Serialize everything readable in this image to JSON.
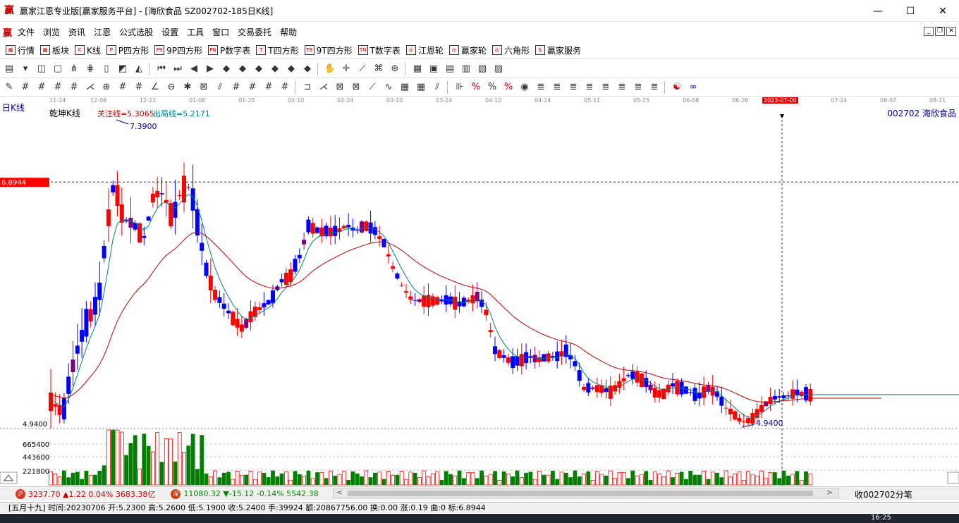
{
  "window": {
    "logo": "赢",
    "title": "赢家江恩专业版[赢家服务平台] - [海欣食品  SZ002702-185日K线]",
    "minimize": "—",
    "maximize": "☐",
    "close": "✕"
  },
  "menu": {
    "logo": "赢",
    "items": [
      "文件",
      "浏览",
      "资讯",
      "江恩",
      "公式选股",
      "设置",
      "工具",
      "窗口",
      "交易委托",
      "帮助"
    ],
    "mdi": [
      "_",
      "❐",
      "✕"
    ]
  },
  "toolbar1": {
    "items": [
      {
        "label": "行情",
        "icon": "grid-icon"
      },
      {
        "label": "板块",
        "icon": "blocks-icon"
      },
      {
        "label": "K线",
        "icon": "kline-icon"
      },
      {
        "label": "P四方形",
        "icon": "p-square-icon"
      },
      {
        "label": "9P四方形",
        "icon": "p9-square-icon"
      },
      {
        "label": "P数字表",
        "icon": "pn-table-icon"
      },
      {
        "label": "T四方形",
        "icon": "t-square-icon"
      },
      {
        "label": "9T四方形",
        "icon": "t9-square-icon"
      },
      {
        "label": "T数字表",
        "icon": "tn-table-icon"
      },
      {
        "label": "江恩轮",
        "icon": "gann-wheel-icon"
      },
      {
        "label": "赢家轮",
        "icon": "winner-wheel-icon"
      },
      {
        "label": "六角形",
        "icon": "hexagon-icon"
      },
      {
        "label": "赢家服务",
        "icon": "dollar-icon"
      }
    ],
    "icon_text": [
      "▦",
      "▩",
      "K",
      "P",
      "P9",
      "PN",
      "T",
      "T9",
      "TN",
      "◎",
      "◎",
      "◎",
      "$"
    ]
  },
  "dates": {
    "ticks": [
      "11-24",
      "12-08",
      "12-22",
      "01-06",
      "01-20",
      "02-10",
      "02-24",
      "03-10",
      "03-24",
      "04-10",
      "04-24",
      "05-11",
      "05-25",
      "06-08",
      "06-26",
      "2023-07-06",
      "07-24",
      "08-07",
      "08-21"
    ],
    "highlight_index": 15
  },
  "chart": {
    "period_label": "日K线",
    "indicator_name": "乾坤K线",
    "attention_line": "关注线=5.3065",
    "exit_line": "出局线=5.2171",
    "stock": "002702  海欣食品",
    "high_label": "7.3900",
    "low_label": "4.9400",
    "cursor_price": "6.8944",
    "price_low_axis": "4.9400",
    "vol_axis": [
      "665400",
      "443600",
      "221800"
    ],
    "colors": {
      "up": "#ff0000",
      "down": "#0000ff",
      "flat": "#800080",
      "ma_fast": "#008080",
      "ma_slow": "#c00000",
      "vol_up": "#ff0000",
      "vol_down": "#008000"
    }
  },
  "bottom": {
    "sh_icon": "沪",
    "sh_text": "3237.70 ▲1.22 0.04% 3683.38亿",
    "sz_icon": "深",
    "sz_text": "11080.32 ▼-15.12 -0.14% 5542.38",
    "right_text": "收002702分笔"
  },
  "status": "[五月十九] 时间:20230706 开:5.2300 高:5.2600 低:5.1900 收:5.2400 手:39924 额:20867756.00 换:0.00 涨:0.19 曲:0 标:6.8944",
  "clock": "16:25"
}
